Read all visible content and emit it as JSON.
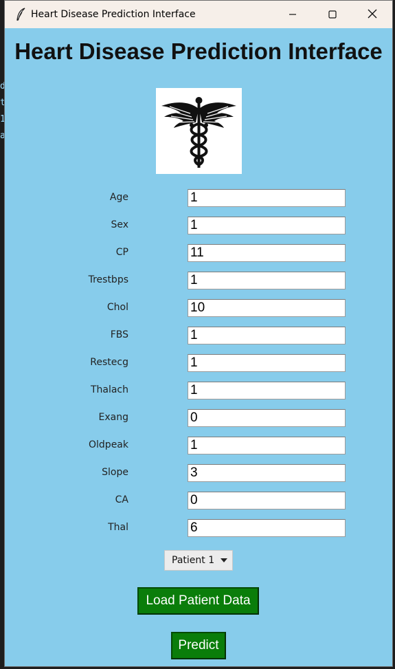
{
  "window": {
    "title": "Heart Disease Prediction Interface"
  },
  "heading": "Heart Disease Prediction Interface",
  "fields": [
    {
      "label": "Age",
      "value": "1"
    },
    {
      "label": "Sex",
      "value": "1"
    },
    {
      "label": "CP",
      "value": "11"
    },
    {
      "label": "Trestbps",
      "value": "1"
    },
    {
      "label": "Chol",
      "value": "10"
    },
    {
      "label": "FBS",
      "value": "1"
    },
    {
      "label": "Restecg",
      "value": "1"
    },
    {
      "label": "Thalach",
      "value": "1"
    },
    {
      "label": "Exang",
      "value": "0"
    },
    {
      "label": "Oldpeak",
      "value": "1"
    },
    {
      "label": "Slope",
      "value": "3"
    },
    {
      "label": "CA",
      "value": "0"
    },
    {
      "label": "Thal",
      "value": "6"
    }
  ],
  "patient_select": {
    "selected": "Patient 1"
  },
  "buttons": {
    "load": "Load Patient Data",
    "predict": "Predict"
  },
  "icons": {
    "app": "feather-icon",
    "logo": "caduceus-icon",
    "minimize": "minimize-icon",
    "maximize": "maximize-icon",
    "close": "close-icon",
    "dropdown": "caret-down-icon"
  },
  "colors": {
    "window_bg": "#87cceb",
    "button_bg": "#0a7d0a",
    "titlebar_bg": "#f6efe9"
  }
}
